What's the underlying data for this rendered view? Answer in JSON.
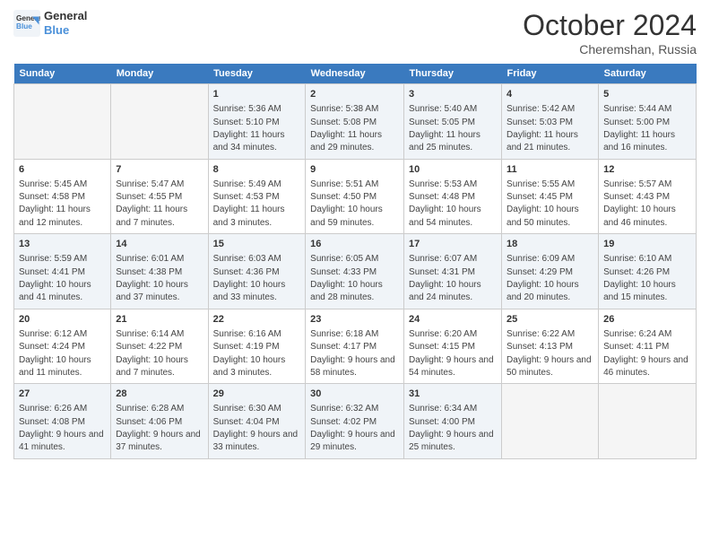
{
  "header": {
    "logo_line1": "General",
    "logo_line2": "Blue",
    "month": "October 2024",
    "location": "Cheremshan, Russia"
  },
  "weekdays": [
    "Sunday",
    "Monday",
    "Tuesday",
    "Wednesday",
    "Thursday",
    "Friday",
    "Saturday"
  ],
  "weeks": [
    [
      {
        "day": "",
        "empty": true
      },
      {
        "day": "",
        "empty": true
      },
      {
        "day": "1",
        "sunrise": "5:36 AM",
        "sunset": "5:10 PM",
        "daylight": "11 hours and 34 minutes."
      },
      {
        "day": "2",
        "sunrise": "5:38 AM",
        "sunset": "5:08 PM",
        "daylight": "11 hours and 29 minutes."
      },
      {
        "day": "3",
        "sunrise": "5:40 AM",
        "sunset": "5:05 PM",
        "daylight": "11 hours and 25 minutes."
      },
      {
        "day": "4",
        "sunrise": "5:42 AM",
        "sunset": "5:03 PM",
        "daylight": "11 hours and 21 minutes."
      },
      {
        "day": "5",
        "sunrise": "5:44 AM",
        "sunset": "5:00 PM",
        "daylight": "11 hours and 16 minutes."
      }
    ],
    [
      {
        "day": "6",
        "sunrise": "5:45 AM",
        "sunset": "4:58 PM",
        "daylight": "11 hours and 12 minutes."
      },
      {
        "day": "7",
        "sunrise": "5:47 AM",
        "sunset": "4:55 PM",
        "daylight": "11 hours and 7 minutes."
      },
      {
        "day": "8",
        "sunrise": "5:49 AM",
        "sunset": "4:53 PM",
        "daylight": "11 hours and 3 minutes."
      },
      {
        "day": "9",
        "sunrise": "5:51 AM",
        "sunset": "4:50 PM",
        "daylight": "10 hours and 59 minutes."
      },
      {
        "day": "10",
        "sunrise": "5:53 AM",
        "sunset": "4:48 PM",
        "daylight": "10 hours and 54 minutes."
      },
      {
        "day": "11",
        "sunrise": "5:55 AM",
        "sunset": "4:45 PM",
        "daylight": "10 hours and 50 minutes."
      },
      {
        "day": "12",
        "sunrise": "5:57 AM",
        "sunset": "4:43 PM",
        "daylight": "10 hours and 46 minutes."
      }
    ],
    [
      {
        "day": "13",
        "sunrise": "5:59 AM",
        "sunset": "4:41 PM",
        "daylight": "10 hours and 41 minutes."
      },
      {
        "day": "14",
        "sunrise": "6:01 AM",
        "sunset": "4:38 PM",
        "daylight": "10 hours and 37 minutes."
      },
      {
        "day": "15",
        "sunrise": "6:03 AM",
        "sunset": "4:36 PM",
        "daylight": "10 hours and 33 minutes."
      },
      {
        "day": "16",
        "sunrise": "6:05 AM",
        "sunset": "4:33 PM",
        "daylight": "10 hours and 28 minutes."
      },
      {
        "day": "17",
        "sunrise": "6:07 AM",
        "sunset": "4:31 PM",
        "daylight": "10 hours and 24 minutes."
      },
      {
        "day": "18",
        "sunrise": "6:09 AM",
        "sunset": "4:29 PM",
        "daylight": "10 hours and 20 minutes."
      },
      {
        "day": "19",
        "sunrise": "6:10 AM",
        "sunset": "4:26 PM",
        "daylight": "10 hours and 15 minutes."
      }
    ],
    [
      {
        "day": "20",
        "sunrise": "6:12 AM",
        "sunset": "4:24 PM",
        "daylight": "10 hours and 11 minutes."
      },
      {
        "day": "21",
        "sunrise": "6:14 AM",
        "sunset": "4:22 PM",
        "daylight": "10 hours and 7 minutes."
      },
      {
        "day": "22",
        "sunrise": "6:16 AM",
        "sunset": "4:19 PM",
        "daylight": "10 hours and 3 minutes."
      },
      {
        "day": "23",
        "sunrise": "6:18 AM",
        "sunset": "4:17 PM",
        "daylight": "9 hours and 58 minutes."
      },
      {
        "day": "24",
        "sunrise": "6:20 AM",
        "sunset": "4:15 PM",
        "daylight": "9 hours and 54 minutes."
      },
      {
        "day": "25",
        "sunrise": "6:22 AM",
        "sunset": "4:13 PM",
        "daylight": "9 hours and 50 minutes."
      },
      {
        "day": "26",
        "sunrise": "6:24 AM",
        "sunset": "4:11 PM",
        "daylight": "9 hours and 46 minutes."
      }
    ],
    [
      {
        "day": "27",
        "sunrise": "6:26 AM",
        "sunset": "4:08 PM",
        "daylight": "9 hours and 41 minutes."
      },
      {
        "day": "28",
        "sunrise": "6:28 AM",
        "sunset": "4:06 PM",
        "daylight": "9 hours and 37 minutes."
      },
      {
        "day": "29",
        "sunrise": "6:30 AM",
        "sunset": "4:04 PM",
        "daylight": "9 hours and 33 minutes."
      },
      {
        "day": "30",
        "sunrise": "6:32 AM",
        "sunset": "4:02 PM",
        "daylight": "9 hours and 29 minutes."
      },
      {
        "day": "31",
        "sunrise": "6:34 AM",
        "sunset": "4:00 PM",
        "daylight": "9 hours and 25 minutes."
      },
      {
        "day": "",
        "empty": true
      },
      {
        "day": "",
        "empty": true
      }
    ]
  ],
  "labels": {
    "sunrise_prefix": "Sunrise: ",
    "sunset_prefix": "Sunset: ",
    "daylight_prefix": "Daylight: "
  }
}
